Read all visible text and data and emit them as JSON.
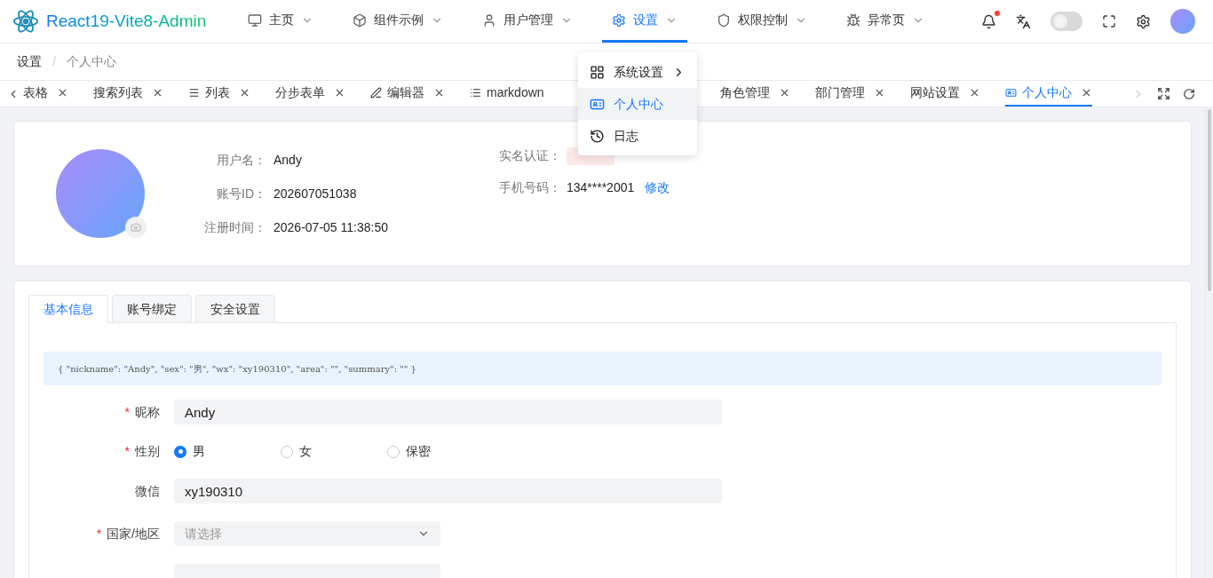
{
  "logo": {
    "title": "React19-Vite8-Admin"
  },
  "nav": [
    {
      "label": "主页",
      "selected": false
    },
    {
      "label": "组件示例",
      "selected": false
    },
    {
      "label": "用户管理",
      "selected": false
    },
    {
      "label": "设置",
      "selected": true
    },
    {
      "label": "权限控制",
      "selected": false
    },
    {
      "label": "异常页",
      "selected": false
    }
  ],
  "header_tools": {
    "notification_dot": true,
    "theme_dark": false
  },
  "breadcrumb": {
    "items": [
      "设置",
      "个人中心"
    ],
    "separator": "/"
  },
  "tabs": [
    {
      "label": "表格",
      "selected": false
    },
    {
      "label": "搜索列表",
      "selected": false
    },
    {
      "label": "列表",
      "selected": false
    },
    {
      "label": "分步表单",
      "selected": false
    },
    {
      "label": "编辑器",
      "selected": false
    },
    {
      "label": "markdown",
      "kind": "covered",
      "selected": false
    },
    {
      "label": "角色管理",
      "selected": false
    },
    {
      "label": "部门管理",
      "selected": false
    },
    {
      "label": "网站设置",
      "selected": false
    },
    {
      "label": "个人中心",
      "selected": true
    }
  ],
  "dropdown": [
    {
      "label": "系统设置",
      "submenu": true,
      "selected": false
    },
    {
      "label": "个人中心",
      "submenu": false,
      "selected": true
    },
    {
      "label": "日志",
      "submenu": false,
      "selected": false
    }
  ],
  "profile": {
    "left": [
      {
        "label": "用户名：",
        "value": "Andy"
      },
      {
        "label": "账号ID：",
        "value": "202607051038"
      },
      {
        "label": "注册时间：",
        "value": "2026-07-05 11:38:50"
      }
    ],
    "verify": {
      "label": "实名认证："
    },
    "phone": {
      "label": "手机号码：",
      "value": "134****2001",
      "link": "修改"
    }
  },
  "form_tabs": [
    {
      "label": "基本信息",
      "selected": true
    },
    {
      "label": "账号绑定",
      "selected": false
    },
    {
      "label": "安全设置",
      "selected": false
    }
  ],
  "json_preview": "{ \"nickname\": \"Andy\", \"sex\": \"男\", \"wx\": \"xy190310\", \"area\": \"\", \"summary\": \"\" }",
  "fields": [
    {
      "kind": "text",
      "label": "昵称",
      "required_mark": "*",
      "value": "Andy"
    },
    {
      "kind": "radio",
      "label": "性别",
      "required_mark": "*",
      "options": [
        {
          "label": "男",
          "selected": true
        },
        {
          "label": "女",
          "selected": false
        },
        {
          "label": "保密",
          "selected": false
        }
      ]
    },
    {
      "kind": "text",
      "label": "微信",
      "value": "xy190310"
    },
    {
      "kind": "select",
      "label": "国家/地区",
      "required_mark": "*",
      "placeholder": "请选择"
    },
    {
      "kind": "cut"
    }
  ]
}
